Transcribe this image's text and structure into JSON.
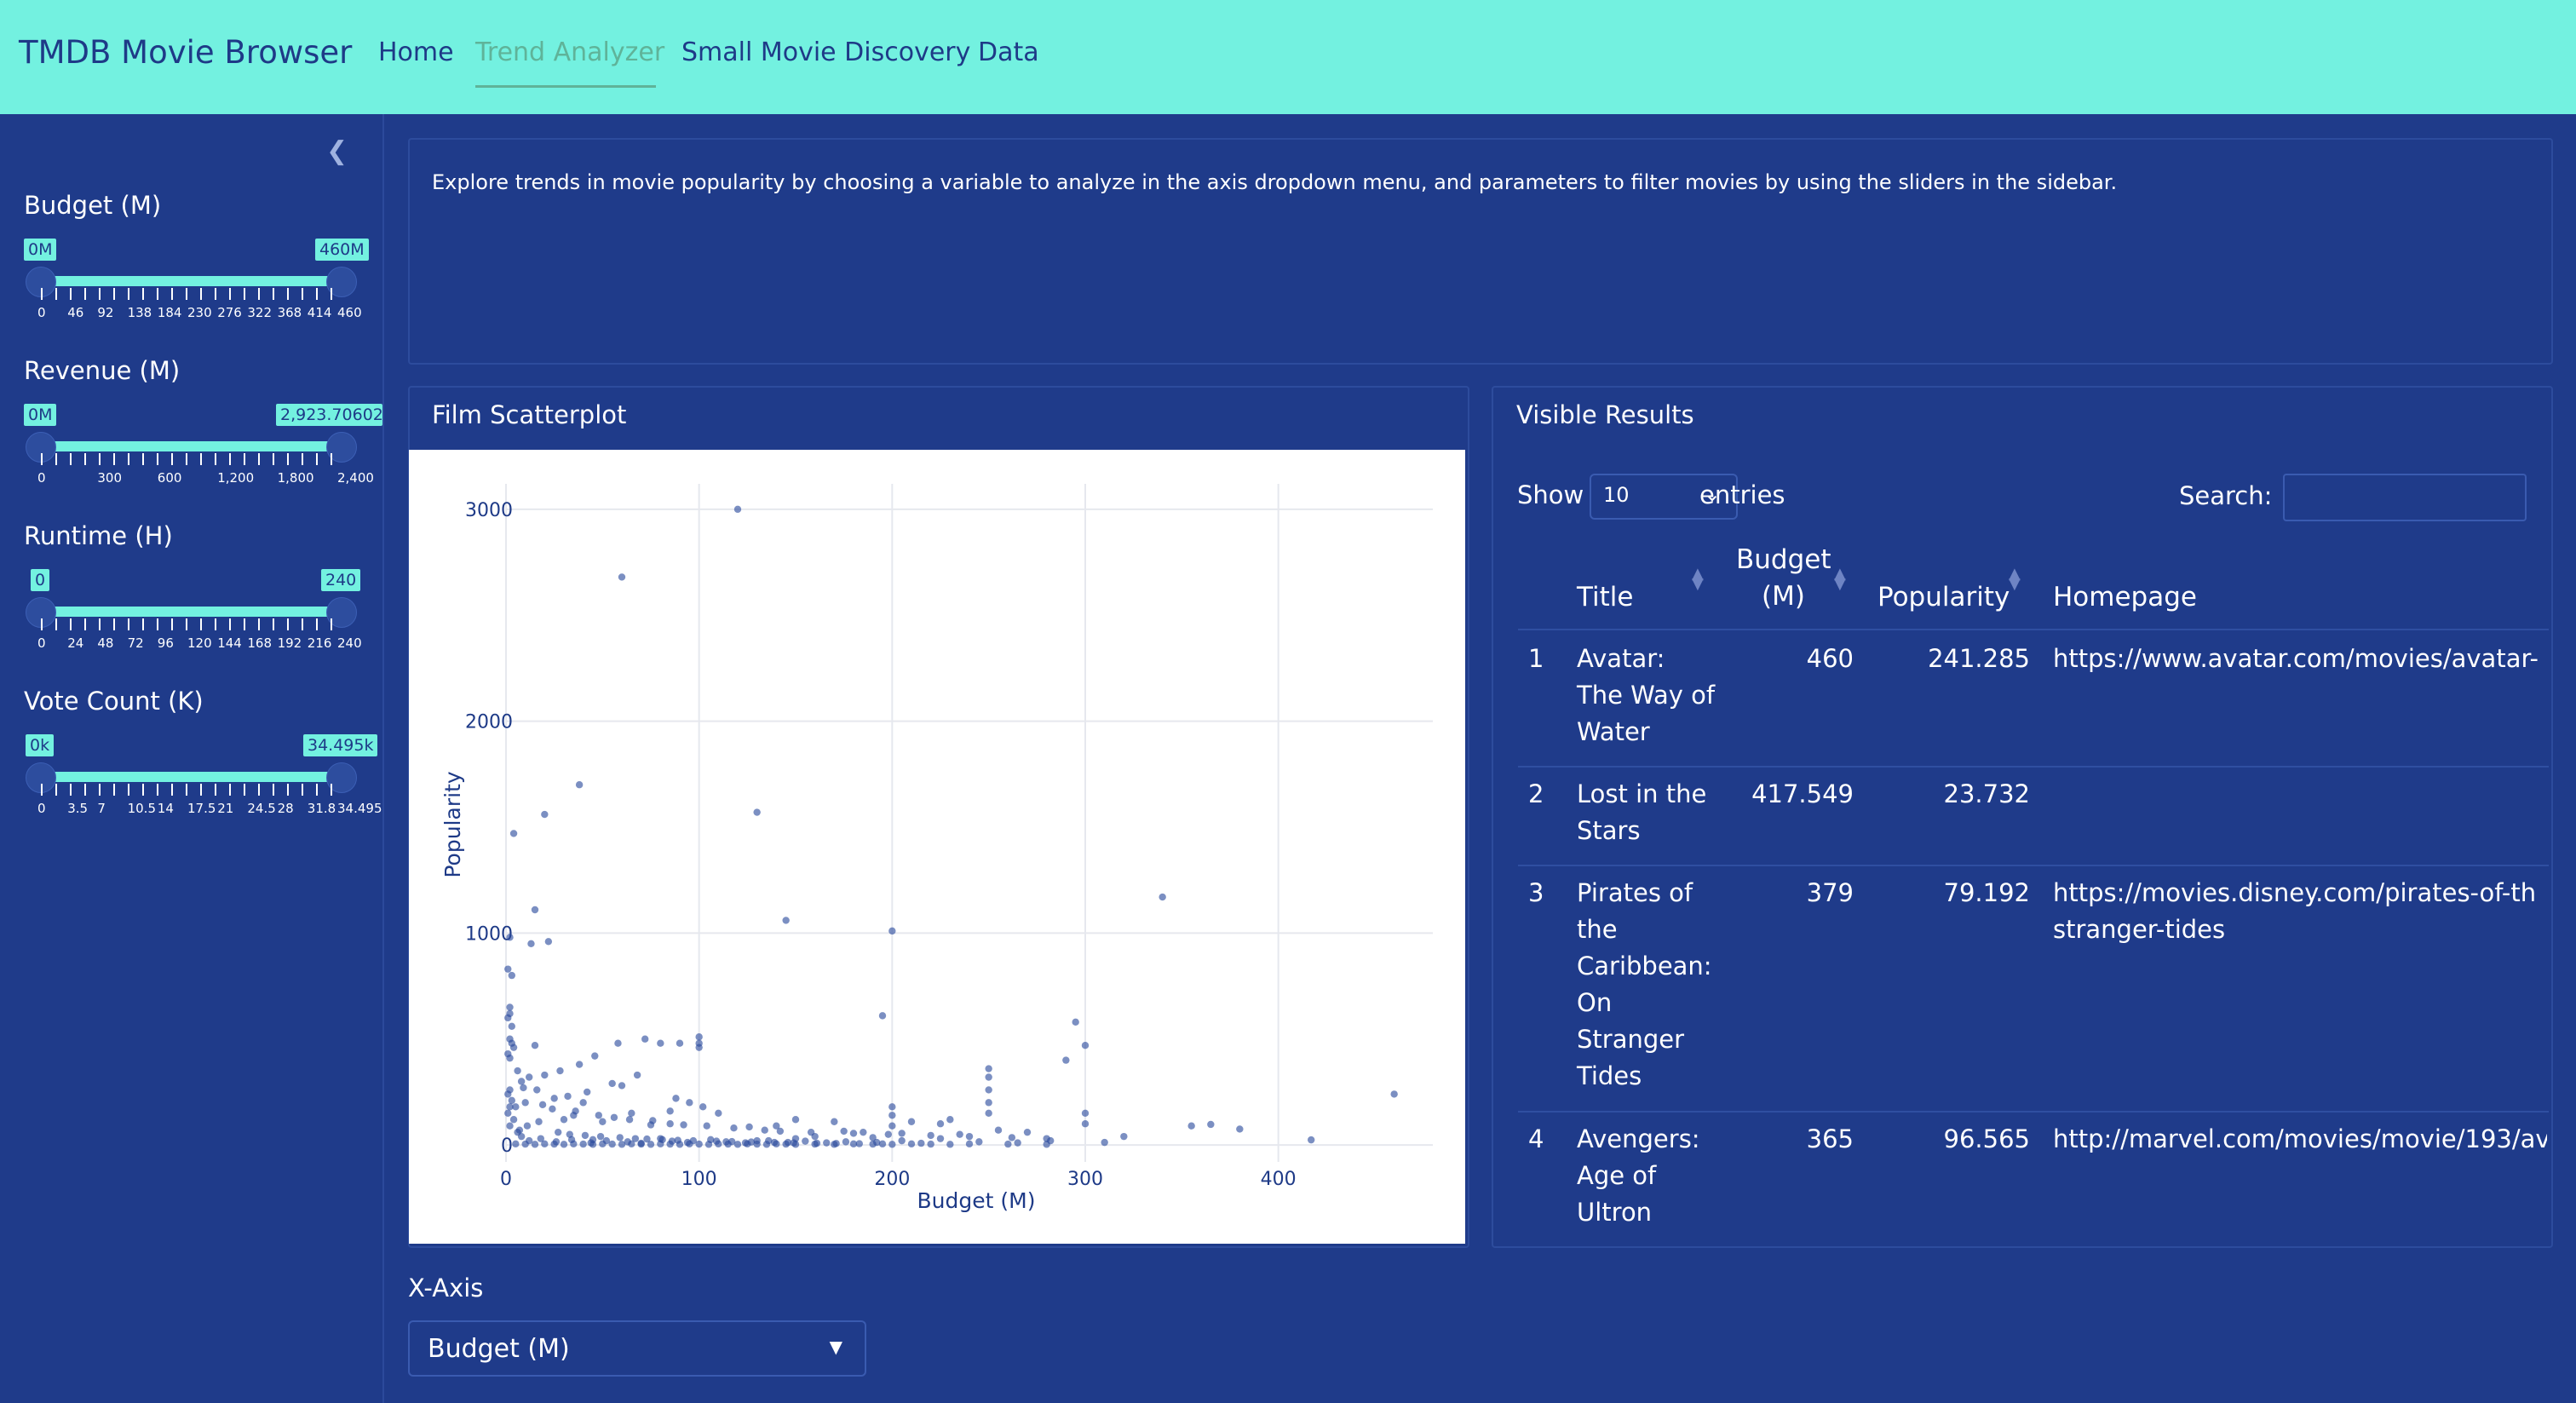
{
  "app": {
    "title": "TMDB Movie Browser",
    "nav": [
      {
        "label": "Home",
        "active": false
      },
      {
        "label": "Trend Analyzer",
        "active": true
      },
      {
        "label": "Small Movie Discovery",
        "active": false
      },
      {
        "label": "Data",
        "active": false
      }
    ]
  },
  "sidebar": {
    "sliders": [
      {
        "label": "Budget (M)",
        "min_badge": "0M",
        "max_badge": "460M",
        "ticks": [
          "0",
          "46",
          "92",
          "138",
          "184",
          "230",
          "276",
          "322",
          "368",
          "414",
          "460"
        ]
      },
      {
        "label": "Revenue (M)",
        "min_badge": "0M",
        "max_badge": "2,923.706026",
        "ticks": [
          "0",
          "300",
          "600",
          "1,200",
          "1,800",
          "2,400"
        ]
      },
      {
        "label": "Runtime (H)",
        "min_badge": "0",
        "max_badge": "240",
        "ticks": [
          "0",
          "24",
          "48",
          "72",
          "96",
          "120",
          "144",
          "168",
          "192",
          "216",
          "240"
        ]
      },
      {
        "label": "Vote Count (K)",
        "min_badge": "0k",
        "max_badge": "34.495k",
        "ticks": [
          "0",
          "3.5",
          "7",
          "10.5",
          "14",
          "17.5",
          "21",
          "24.5",
          "28",
          "31.8",
          "34.495"
        ]
      }
    ]
  },
  "intro": {
    "text": "Explore trends in movie popularity by choosing a variable to analyze in the axis dropdown menu, and parameters to filter movies by using the sliders in the sidebar."
  },
  "scatter_card": {
    "title": "Film Scatterplot"
  },
  "chart_data": {
    "type": "scatter",
    "xlabel": "Budget (M)",
    "ylabel": "Popularity",
    "xlim": [
      0,
      480
    ],
    "ylim": [
      -80,
      3120
    ],
    "xticks": [
      0,
      100,
      200,
      300,
      400
    ],
    "yticks": [
      0,
      1000,
      2000,
      3000
    ],
    "grid": true,
    "color": "#2a4a9c",
    "series": [
      {
        "points": [
          [
            120,
            3000
          ],
          [
            60,
            2680
          ],
          [
            38,
            1700
          ],
          [
            20,
            1560
          ],
          [
            4,
            1470
          ],
          [
            130,
            1570
          ],
          [
            15,
            1110
          ],
          [
            145,
            1060
          ],
          [
            22,
            960
          ],
          [
            13,
            950
          ],
          [
            200,
            1010
          ],
          [
            340,
            1170
          ],
          [
            195,
            610
          ],
          [
            295,
            580
          ],
          [
            300,
            470
          ],
          [
            290,
            400
          ],
          [
            2,
            980
          ],
          [
            1,
            830
          ],
          [
            3,
            800
          ],
          [
            2,
            650
          ],
          [
            2,
            620
          ],
          [
            1,
            600
          ],
          [
            3,
            560
          ],
          [
            2,
            500
          ],
          [
            3,
            480
          ],
          [
            4,
            460
          ],
          [
            1,
            430
          ],
          [
            2,
            410
          ],
          [
            15,
            470
          ],
          [
            100,
            510
          ],
          [
            100,
            480
          ],
          [
            100,
            460
          ],
          [
            72,
            500
          ],
          [
            90,
            480
          ],
          [
            80,
            480
          ],
          [
            58,
            480
          ],
          [
            46,
            420
          ],
          [
            38,
            380
          ],
          [
            28,
            350
          ],
          [
            20,
            330
          ],
          [
            12,
            320
          ],
          [
            8,
            300
          ],
          [
            25,
            220
          ],
          [
            32,
            230
          ],
          [
            60,
            280
          ],
          [
            68,
            330
          ],
          [
            55,
            290
          ],
          [
            42,
            250
          ],
          [
            40,
            200
          ],
          [
            88,
            220
          ],
          [
            95,
            200
          ],
          [
            102,
            180
          ],
          [
            110,
            150
          ],
          [
            250,
            360
          ],
          [
            250,
            320
          ],
          [
            460,
            240
          ],
          [
            365,
            97
          ],
          [
            355,
            90
          ],
          [
            380,
            75
          ],
          [
            300,
            150
          ],
          [
            300,
            100
          ],
          [
            230,
            120
          ],
          [
            210,
            110
          ],
          [
            225,
            100
          ],
          [
            170,
            110
          ],
          [
            140,
            90
          ],
          [
            118,
            80
          ],
          [
            75,
            95
          ],
          [
            50,
            110
          ],
          [
            30,
            120
          ],
          [
            10,
            200
          ],
          [
            5,
            180
          ],
          [
            417,
            24
          ],
          [
            320,
            40
          ],
          [
            270,
            60
          ],
          [
            255,
            70
          ],
          [
            235,
            50
          ],
          [
            185,
            60
          ],
          [
            160,
            40
          ],
          [
            150,
            30
          ],
          [
            130,
            20
          ],
          [
            80,
            30
          ],
          [
            45,
            25
          ],
          [
            2,
            260
          ],
          [
            1,
            240
          ],
          [
            3,
            210
          ],
          [
            2,
            180
          ],
          [
            1,
            150
          ],
          [
            4,
            120
          ],
          [
            2,
            90
          ],
          [
            6,
            60
          ],
          [
            8,
            40
          ],
          [
            12,
            20
          ],
          [
            18,
            30
          ],
          [
            26,
            15
          ],
          [
            34,
            25
          ],
          [
            44,
            10
          ],
          [
            52,
            20
          ],
          [
            63,
            15
          ],
          [
            70,
            8
          ],
          [
            86,
            18
          ],
          [
            94,
            12
          ],
          [
            106,
            25
          ],
          [
            114,
            15
          ],
          [
            124,
            10
          ],
          [
            136,
            20
          ],
          [
            146,
            12
          ],
          [
            155,
            18
          ],
          [
            166,
            10
          ],
          [
            176,
            15
          ],
          [
            192,
            12
          ],
          [
            205,
            20
          ],
          [
            215,
            8
          ],
          [
            245,
            15
          ],
          [
            265,
            10
          ],
          [
            282,
            20
          ],
          [
            310,
            12
          ],
          [
            6,
            350
          ],
          [
            9,
            270
          ],
          [
            16,
            260
          ],
          [
            19,
            190
          ],
          [
            24,
            170
          ],
          [
            36,
            160
          ],
          [
            48,
            140
          ],
          [
            56,
            130
          ],
          [
            64,
            120
          ],
          [
            76,
            115
          ],
          [
            85,
            100
          ],
          [
            92,
            95
          ],
          [
            104,
            90
          ],
          [
            126,
            85
          ],
          [
            134,
            70
          ],
          [
            142,
            65
          ],
          [
            158,
            60
          ],
          [
            180,
            55
          ],
          [
            198,
            50
          ],
          [
            220,
            45
          ],
          [
            240,
            40
          ],
          [
            262,
            35
          ],
          [
            280,
            30
          ],
          [
            200,
            180
          ],
          [
            200,
            140
          ],
          [
            250,
            260
          ],
          [
            250,
            200
          ],
          [
            250,
            150
          ],
          [
            200,
            90
          ],
          [
            150,
            120
          ],
          [
            190,
            35
          ],
          [
            225,
            30
          ],
          [
            205,
            55
          ],
          [
            175,
            65
          ],
          [
            85,
            160
          ],
          [
            65,
            150
          ],
          [
            35,
            140
          ],
          [
            17,
            110
          ],
          [
            11,
            90
          ],
          [
            7,
            70
          ],
          [
            27,
            60
          ],
          [
            33,
            50
          ],
          [
            41,
            45
          ],
          [
            49,
            40
          ],
          [
            59,
            35
          ],
          [
            67,
            30
          ],
          [
            73,
            28
          ],
          [
            81,
            25
          ],
          [
            89,
            22
          ],
          [
            97,
            20
          ],
          [
            109,
            18
          ],
          [
            117,
            16
          ],
          [
            127,
            14
          ],
          [
            139,
            12
          ],
          [
            149,
            10
          ],
          [
            161,
            8
          ],
          [
            171,
            7
          ],
          [
            183,
            6
          ],
          [
            195,
            5
          ],
          [
            5,
            5
          ],
          [
            10,
            4
          ],
          [
            15,
            3
          ],
          [
            20,
            5
          ],
          [
            25,
            4
          ],
          [
            30,
            3
          ],
          [
            35,
            5
          ],
          [
            40,
            4
          ],
          [
            45,
            3
          ],
          [
            50,
            5
          ],
          [
            55,
            4
          ],
          [
            60,
            3
          ],
          [
            65,
            5
          ],
          [
            70,
            4
          ],
          [
            75,
            3
          ],
          [
            80,
            5
          ],
          [
            85,
            4
          ],
          [
            90,
            3
          ],
          [
            95,
            5
          ],
          [
            100,
            4
          ],
          [
            105,
            3
          ],
          [
            110,
            5
          ],
          [
            115,
            4
          ],
          [
            120,
            3
          ],
          [
            125,
            5
          ],
          [
            130,
            4
          ],
          [
            135,
            3
          ],
          [
            140,
            5
          ],
          [
            145,
            4
          ],
          [
            150,
            3
          ],
          [
            160,
            4
          ],
          [
            170,
            3
          ],
          [
            180,
            5
          ],
          [
            190,
            4
          ],
          [
            200,
            3
          ],
          [
            210,
            5
          ],
          [
            220,
            4
          ],
          [
            230,
            3
          ],
          [
            240,
            5
          ],
          [
            260,
            4
          ],
          [
            280,
            3
          ]
        ]
      }
    ]
  },
  "results": {
    "title": "Visible Results",
    "show_label": "Show",
    "entries_value": "10",
    "entries_label": "entries",
    "search_label": "Search:",
    "search_value": "",
    "columns": [
      "Title",
      "Budget (M)",
      "Popularity",
      "Homepage"
    ],
    "budget_header_lines": [
      "Budget",
      "(M)"
    ],
    "rows": [
      {
        "n": "1",
        "title": [
          "Avatar:",
          "The Way of",
          "Water"
        ],
        "budget": "460",
        "popularity": "241.285",
        "homepage": [
          "https://www.avatar.com/movies/avatar-"
        ]
      },
      {
        "n": "2",
        "title": [
          "Lost in the",
          "Stars"
        ],
        "budget": "417.549",
        "popularity": "23.732",
        "homepage": []
      },
      {
        "n": "3",
        "title": [
          "Pirates of",
          "the",
          "Caribbean:",
          "On",
          "Stranger",
          "Tides"
        ],
        "budget": "379",
        "popularity": "79.192",
        "homepage": [
          "https://movies.disney.com/pirates-of-th",
          "stranger-tides"
        ]
      },
      {
        "n": "4",
        "title": [
          "Avengers:",
          "Age of",
          "Ultron"
        ],
        "budget": "365",
        "popularity": "96.565",
        "homepage": [
          "http://marvel.com/movies/movie/193/av"
        ]
      }
    ]
  },
  "xaxis": {
    "label": "X-Axis",
    "selected": "Budget (M)"
  }
}
